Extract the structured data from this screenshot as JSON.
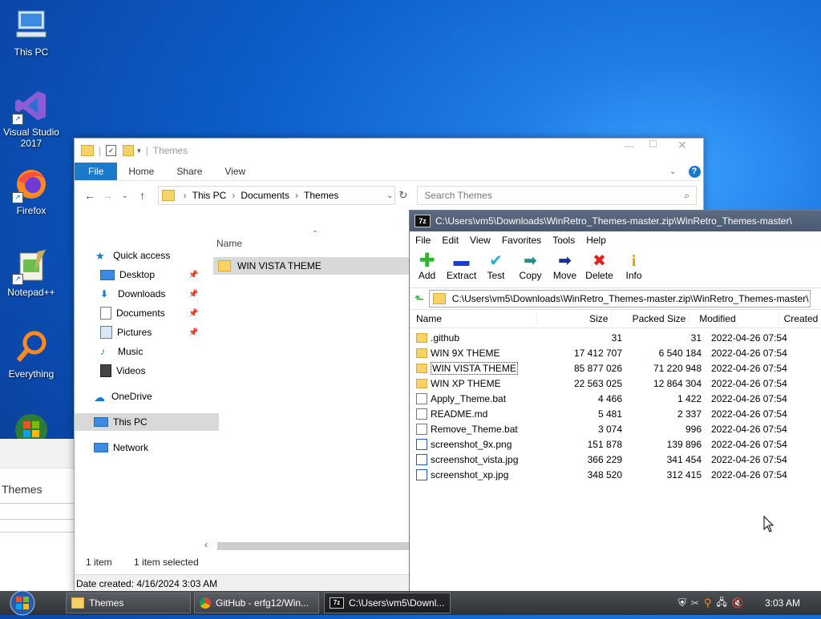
{
  "desktop": {
    "icons": [
      {
        "label": "This PC"
      },
      {
        "label": "Visual Studio 2017"
      },
      {
        "label": "Firefox"
      },
      {
        "label": "Notepad++"
      },
      {
        "label": "Everything"
      }
    ]
  },
  "background_window": {
    "title": "Themes"
  },
  "explorer": {
    "title": "Themes",
    "ribbon_tabs": [
      "File",
      "Home",
      "Share",
      "View"
    ],
    "breadcrumb": [
      "This PC",
      "Documents",
      "Themes"
    ],
    "search_placeholder": "Search Themes",
    "column_name": "Name",
    "files": [
      "WIN VISTA THEME"
    ],
    "nav": {
      "quick_access": "Quick access",
      "desktop": "Desktop",
      "downloads": "Downloads",
      "documents": "Documents",
      "pictures": "Pictures",
      "music": "Music",
      "videos": "Videos",
      "onedrive": "OneDrive",
      "this_pc": "This PC",
      "network": "Network"
    },
    "status_items": "1 item",
    "status_selected": "1 item selected",
    "date_created": "Date created: 4/16/2024 3:03 AM"
  },
  "sevenzip": {
    "title": "C:\\Users\\vm5\\Downloads\\WinRetro_Themes-master.zip\\WinRetro_Themes-master\\",
    "menu": [
      "File",
      "Edit",
      "View",
      "Favorites",
      "Tools",
      "Help"
    ],
    "tools": [
      "Add",
      "Extract",
      "Test",
      "Copy",
      "Move",
      "Delete",
      "Info"
    ],
    "path": "C:\\Users\\vm5\\Downloads\\WinRetro_Themes-master.zip\\WinRetro_Themes-master\\",
    "columns": {
      "name": "Name",
      "size": "Size",
      "packed": "Packed Size",
      "modified": "Modified",
      "created": "Created"
    },
    "rows": [
      {
        "name": ".github",
        "size": "31",
        "packed": "31",
        "modified": "2022-04-26 07:54"
      },
      {
        "name": "WIN 9X THEME",
        "size": "17 412 707",
        "packed": "6 540 184",
        "modified": "2022-04-26 07:54"
      },
      {
        "name": "WIN VISTA THEME",
        "size": "85 877 026",
        "packed": "71 220 948",
        "modified": "2022-04-26 07:54"
      },
      {
        "name": "WIN XP THEME",
        "size": "22 563 025",
        "packed": "12 864 304",
        "modified": "2022-04-26 07:54"
      },
      {
        "name": "Apply_Theme.bat",
        "size": "4 466",
        "packed": "1 422",
        "modified": "2022-04-26 07:54"
      },
      {
        "name": "README.md",
        "size": "5 481",
        "packed": "2 337",
        "modified": "2022-04-26 07:54"
      },
      {
        "name": "Remove_Theme.bat",
        "size": "3 074",
        "packed": "996",
        "modified": "2022-04-26 07:54"
      },
      {
        "name": "screenshot_9x.png",
        "size": "151 878",
        "packed": "139 896",
        "modified": "2022-04-26 07:54"
      },
      {
        "name": "screenshot_vista.jpg",
        "size": "366 229",
        "packed": "341 454",
        "modified": "2022-04-26 07:54"
      },
      {
        "name": "screenshot_xp.jpg",
        "size": "348 520",
        "packed": "312 415",
        "modified": "2022-04-26 07:54"
      }
    ]
  },
  "taskbar": {
    "buttons": [
      "Themes",
      "GitHub - erfg12/Win...",
      "C:\\Users\\vm5\\Downl..."
    ],
    "clock": "3:03 AM"
  }
}
